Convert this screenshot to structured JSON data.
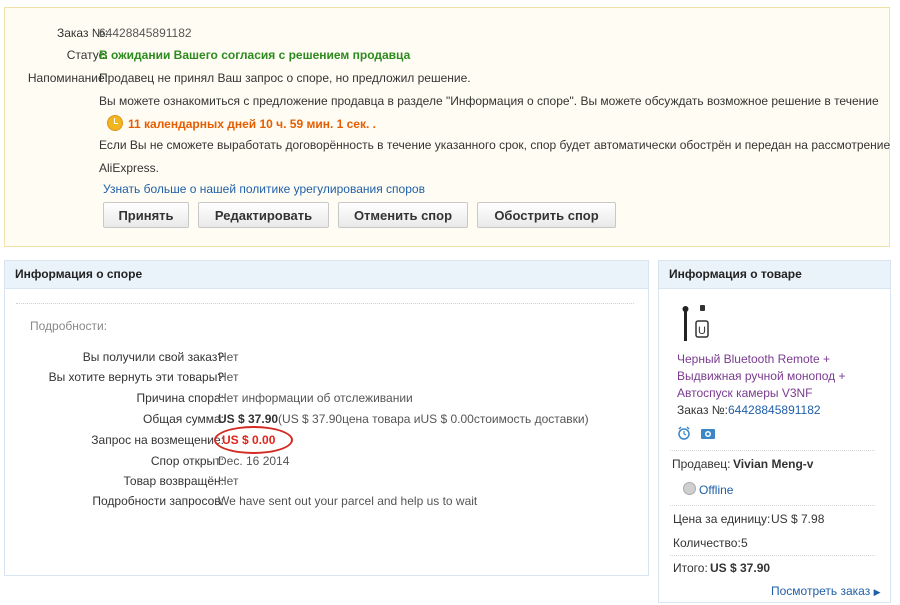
{
  "order": {
    "number_label": "Заказ №:",
    "number": "64428845891182",
    "status_label": "Статус:",
    "status": "В ожидании Вашего согласия с решением продавца",
    "reminder_label": "Напоминание:",
    "reminder_line1": "Продавец не принял Ваш запрос о споре, но предложил решение.",
    "reminder_line2": "Вы можете ознакомиться с предложение продавца в разделе \"Информация о споре\". Вы можете обсуждать возможное решение в течение",
    "countdown": "11 календарных дней 10 ч. 59 мин. 1 сек. .",
    "reminder_line3": "Если Вы не сможете выработать договорённость в течение указанного срок, спор будет автоматически обострён и передан на рассмотрение",
    "reminder_line4": "AliExpress.",
    "policy_link": "Узнать больше о нашей политике урегулирования споров"
  },
  "buttons": {
    "accept": "Принять",
    "edit": "Редактировать",
    "cancel": "Отменить спор",
    "escalate": "Обострить спор"
  },
  "dispute": {
    "title": "Информация о споре",
    "details_heading": "Подробности:",
    "rows": [
      {
        "label": "Вы получили свой заказ?",
        "value": "Нет"
      },
      {
        "label": "Вы хотите вернуть эти товары?",
        "value": "Нет"
      },
      {
        "label": "Причина спора:",
        "value": "Нет информации об отслеживании"
      },
      {
        "label": "Общая сумма:",
        "value_bold": "US $ 37.90",
        "value_rest": "(US $ 37.90цена товара иUS $ 0.00стоимость доставки)"
      },
      {
        "label": "Запрос на возмещение:",
        "value": "US $ 0.00"
      },
      {
        "label": "Спор открыт:",
        "value": "Dec. 16 2014"
      },
      {
        "label": "Товар возвращён:",
        "value": "Нет"
      },
      {
        "label": "Подробности запросов:",
        "value": "We have sent out your parcel and help us to wait"
      }
    ]
  },
  "product": {
    "title": "Информация о товаре",
    "name_line1": "Черный Bluetooth Remote +",
    "name_line2": "Выдвижная ручной монопод +",
    "name_line3": "Автоспуск камеры V3NF",
    "order_label": "Заказ №:",
    "order_number": "64428845891182",
    "seller_label": "Продавец:",
    "seller_name": "Vivian Meng-v",
    "online_status": "Offline",
    "unit_price_label": "Цена за единицу:",
    "unit_price": "US $ 7.98",
    "quantity_label": "Количество:",
    "quantity": "5",
    "total_label": "Итого:",
    "total": "US $ 37.90",
    "view_order": "Посмотреть заказ"
  },
  "colors": {
    "status_green": "#2c8a1e",
    "countdown_orange": "#e65c00",
    "refund_red": "#e2231a",
    "link_blue": "#1f5fa8",
    "product_purple": "#7a3b8f"
  }
}
